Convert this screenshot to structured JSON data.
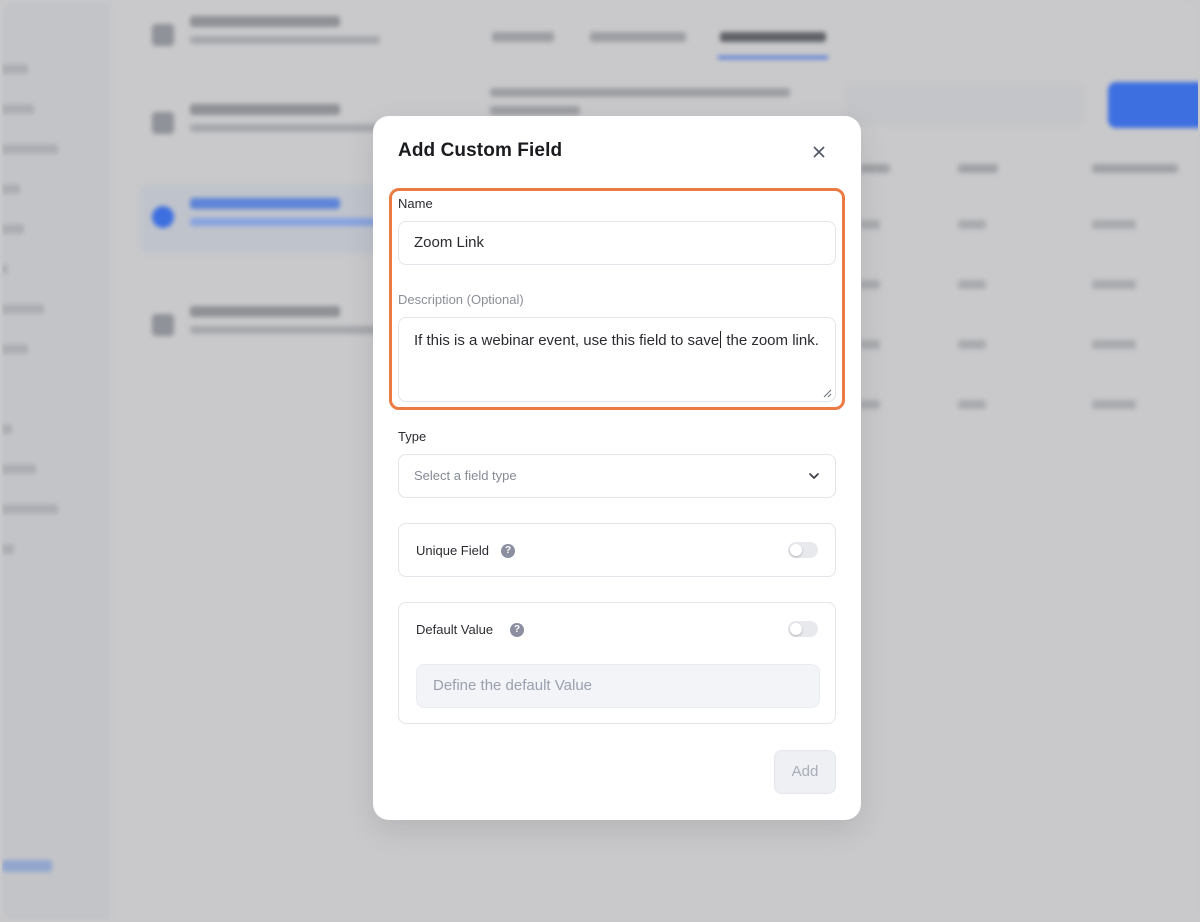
{
  "modal": {
    "title": "Add Custom Field",
    "name_label": "Name",
    "name_value": "Zoom Link",
    "description_label": "Description (Optional)",
    "description_value_before_caret": "If this is a webinar event, use this field to save",
    "description_value_after_caret": " the zoom link.",
    "type_label": "Type",
    "type_placeholder": "Select a field type",
    "unique_field_label": "Unique Field",
    "unique_field_enabled": false,
    "default_value_label": "Default Value",
    "default_value_enabled": false,
    "default_value_placeholder": "Define the default Value",
    "add_button_label": "Add",
    "help_glyph": "?"
  },
  "colors": {
    "highlight": "#ec7a43",
    "overlay": "#c8c8ca",
    "accent_blue": "#3d6fe0"
  },
  "icons": {
    "close": "close-icon",
    "dropdown": "chevron-down-icon",
    "help": "help-circle-icon"
  }
}
